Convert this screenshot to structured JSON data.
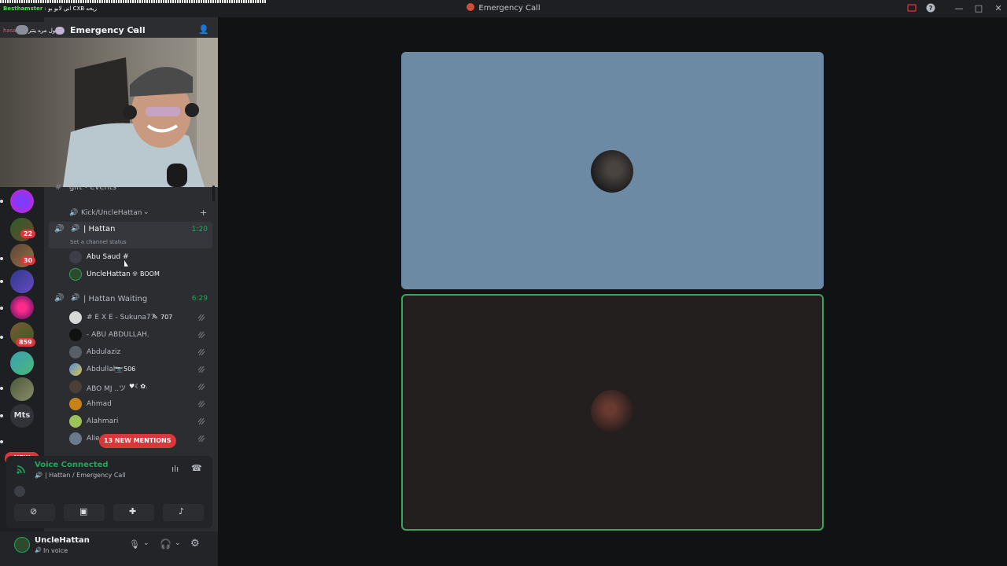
{
  "window": {
    "title": "Emergency Call"
  },
  "overlay_chat": {
    "line1_user": "Besthamster",
    "line1_text": ": اني لابو بو CXB ريحه",
    "line2_user": "hasa",
    "line2_text": "اول مره يتتر"
  },
  "server": {
    "channel_title": "Emergency Call"
  },
  "guilds": [
    {
      "badge": ""
    },
    {
      "badge": "22"
    },
    {
      "badge": "30"
    },
    {
      "badge": ""
    },
    {
      "badge": ""
    },
    {
      "badge": "859"
    },
    {
      "badge": ""
    },
    {
      "badge": ""
    }
  ],
  "guild_text": "Mts",
  "new_label": "NEW",
  "channels": {
    "partial_channel": "gift - events",
    "category": "Kick/UncleHattan",
    "voice_channel_1": {
      "name": "| Hattan",
      "time": "1:20",
      "status_placeholder": "Set a channel status",
      "members": [
        {
          "name": "Abu Saud #",
          "extra": ""
        },
        {
          "name": "UncleHattan",
          "extra": "BOOM"
        }
      ]
    },
    "voice_channel_2": {
      "name": "| Hattan Waiting",
      "time": "6:29",
      "members": [
        {
          "name": "# E X E - Sukuna77",
          "extra": "707"
        },
        {
          "name": "- ABU ABDULLAH.",
          "extra": ""
        },
        {
          "name": "Abdulaziz",
          "extra": ""
        },
        {
          "name": "Abdullah",
          "extra": "506"
        },
        {
          "name": "ABO MJ ..ツ",
          "extra": "♥☾✿."
        },
        {
          "name": "Ahmad",
          "extra": ""
        },
        {
          "name": "Alahmari",
          "extra": ""
        },
        {
          "name": "Alie",
          "extra": ""
        }
      ]
    }
  },
  "mentions_label": "13 NEW MENTIONS",
  "voice_panel": {
    "status": "Voice Connected",
    "location": "| Hattan / Emergency Call"
  },
  "user_panel": {
    "username": "UncleHattan",
    "status": "In voice"
  },
  "colors": {
    "green": "#23a55a",
    "tile1_bg": "#6d8aa4",
    "tile2_bg": "#231f1e",
    "tile2_border": "#3ba55c",
    "mention_red": "#da373c"
  }
}
